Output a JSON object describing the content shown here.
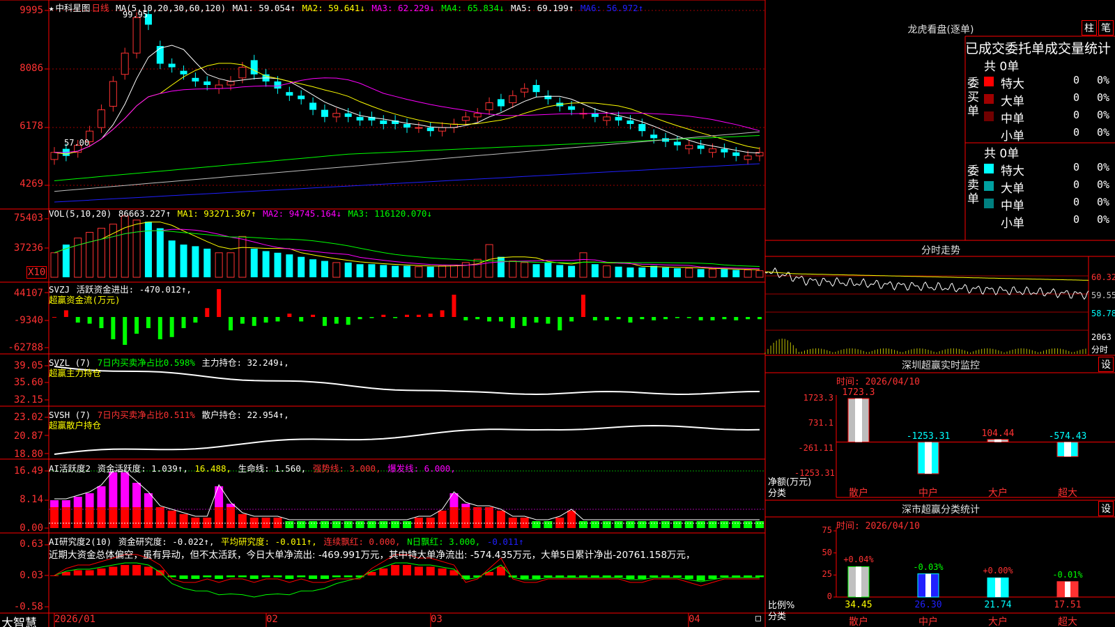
{
  "colors": {
    "up": "#ff3232",
    "down": "#00ffff",
    "grid": "#a00000",
    "axis": "#ff0000"
  },
  "main": {
    "header": {
      "stock_name": "中科星图",
      "period": "日线",
      "ma_label": "MA(5,10,20,30,60,120)",
      "ma1": "MA1: 59.054↑",
      "ma2": "MA2: 59.641↓",
      "ma3": "MA3: 62.229↓",
      "ma4": "MA4: 65.834↓",
      "ma5": "MA5: 69.199↑",
      "ma6": "MA6: 56.972↑"
    },
    "y_ticks": [
      "9995",
      "8086",
      "6178",
      "4269"
    ],
    "high_label": "99.95",
    "low_label": "57.00"
  },
  "vol": {
    "header": {
      "label": "VOL(5,10,20)",
      "value": "86663.227↑",
      "ma1": "MA1: 93271.367↑",
      "ma2": "MA2: 94745.164↓",
      "ma3": "MA3: 116120.070↓"
    },
    "y_ticks": [
      "75403",
      "37236"
    ],
    "unit": "X10"
  },
  "svzj": {
    "header": {
      "label": "SVZJ",
      "value": "活跃资金进出: -470.012↑,",
      "sub": "超赢资金流(万元)"
    },
    "y_ticks": [
      "44107",
      "-9340",
      "-62788"
    ]
  },
  "svzl": {
    "header": {
      "label": "SVZL (7)",
      "ratio": "7日内买卖净占比0.598%",
      "hold": "主力持仓: 32.249↓,",
      "sub": "超赢主力持仓"
    },
    "y_ticks": [
      "39.05",
      "35.60",
      "32.15"
    ]
  },
  "svsh": {
    "header": {
      "label": "SVSH (7)",
      "ratio": "7日内买卖净占比0.511%",
      "hold": "散户持仓: 22.954↑,",
      "sub": "超赢散户持仓"
    },
    "y_ticks": [
      "23.02",
      "20.87",
      "18.80"
    ]
  },
  "ai2": {
    "header": {
      "label": "AI活跃度2",
      "activity": "资金活跃度: 1.039↑,",
      "v2": "16.488,",
      "life": "生命线: 1.560,",
      "strong": "强势线: 3.000,",
      "burst": "爆发线: 6.000,"
    },
    "y_ticks": [
      "16.49",
      "8.14",
      "0.00"
    ]
  },
  "ai_research": {
    "header": {
      "label": "AI研究度2(10)",
      "research": "资金研究度: -0.022↑,",
      "avg": "平均研究度: -0.011↑,",
      "cont": "连续飘红: 0.000,",
      "nday": "N日飘红: 3.000,",
      "last": "-0.011↑"
    },
    "comment": "近期大资金总体偏空，虽有异动，但不太活跃，今日大单净流出: -469.991万元，其中特大单净流出: -574.435万元，大单5日累计净出-20761.158万元，",
    "y_ticks": [
      "0.63",
      "0.03",
      "-0.58"
    ]
  },
  "x_axis": {
    "labels": [
      "2026/01",
      "02",
      "03",
      "04"
    ]
  },
  "logo": "大智慧",
  "right": {
    "dragon": {
      "title": "龙虎看盘(逐单)",
      "btn_bar": "柱",
      "btn_pen": "笔",
      "subtitle": "已成交委托单成交量统计",
      "buy": {
        "side_label": "委买单",
        "total": "共 0单",
        "rows": [
          {
            "label": "特大",
            "count": "0",
            "pct": "0%",
            "color": "#ff0000"
          },
          {
            "label": "大单",
            "count": "0",
            "pct": "0%",
            "color": "#a00000"
          },
          {
            "label": "中单",
            "count": "0",
            "pct": "0%",
            "color": "#700000"
          },
          {
            "label": "小单",
            "count": "0",
            "pct": "0%",
            "color": "#000000"
          }
        ]
      },
      "sell": {
        "side_label": "委卖单",
        "total": "共 0单",
        "rows": [
          {
            "label": "特大",
            "count": "0",
            "pct": "0%",
            "color": "#00ffff"
          },
          {
            "label": "大单",
            "count": "0",
            "pct": "0%",
            "color": "#00a0a0"
          },
          {
            "label": "中单",
            "count": "0",
            "pct": "0%",
            "color": "#008080"
          },
          {
            "label": "小单",
            "count": "0",
            "pct": "0%",
            "color": "#000000"
          }
        ]
      }
    },
    "intraday": {
      "title": "分时走势",
      "prices": [
        "60.32",
        "59.55",
        "58.78"
      ],
      "vol": "2063",
      "vol_label": "分时"
    },
    "monitor": {
      "title": "深圳超赢实时监控",
      "btn": "设",
      "time": "时间: 2026/04/10",
      "y_ticks": [
        "1723.3",
        "731.1",
        "-261.11",
        "-1253.31"
      ],
      "unit_label": "净额(万元)",
      "class_label": "分类",
      "bars": [
        {
          "name": "散户",
          "value": 1723.3,
          "label": "1723.3"
        },
        {
          "name": "中户",
          "value": -1253.31,
          "label": "-1253.31"
        },
        {
          "name": "大户",
          "value": 104.44,
          "label": "104.44"
        },
        {
          "name": "超大",
          "value": -574.43,
          "label": "-574.43"
        }
      ]
    },
    "classify": {
      "title": "深市超赢分类统计",
      "btn": "设",
      "time": "时间: 2026/04/10",
      "y_ticks": [
        "75",
        "50",
        "25",
        "0"
      ],
      "unit_label": "比例%",
      "class_label": "分类",
      "bars": [
        {
          "name": "散户",
          "value": 34.45,
          "label": "34.45",
          "delta": "+0.04%"
        },
        {
          "name": "中户",
          "value": 26.3,
          "label": "26.30",
          "delta": "-0.03%"
        },
        {
          "name": "大户",
          "value": 21.74,
          "label": "21.74",
          "delta": "+0.00%"
        },
        {
          "name": "超大",
          "value": 17.51,
          "label": "17.51",
          "delta": "-0.01%"
        }
      ]
    }
  }
}
